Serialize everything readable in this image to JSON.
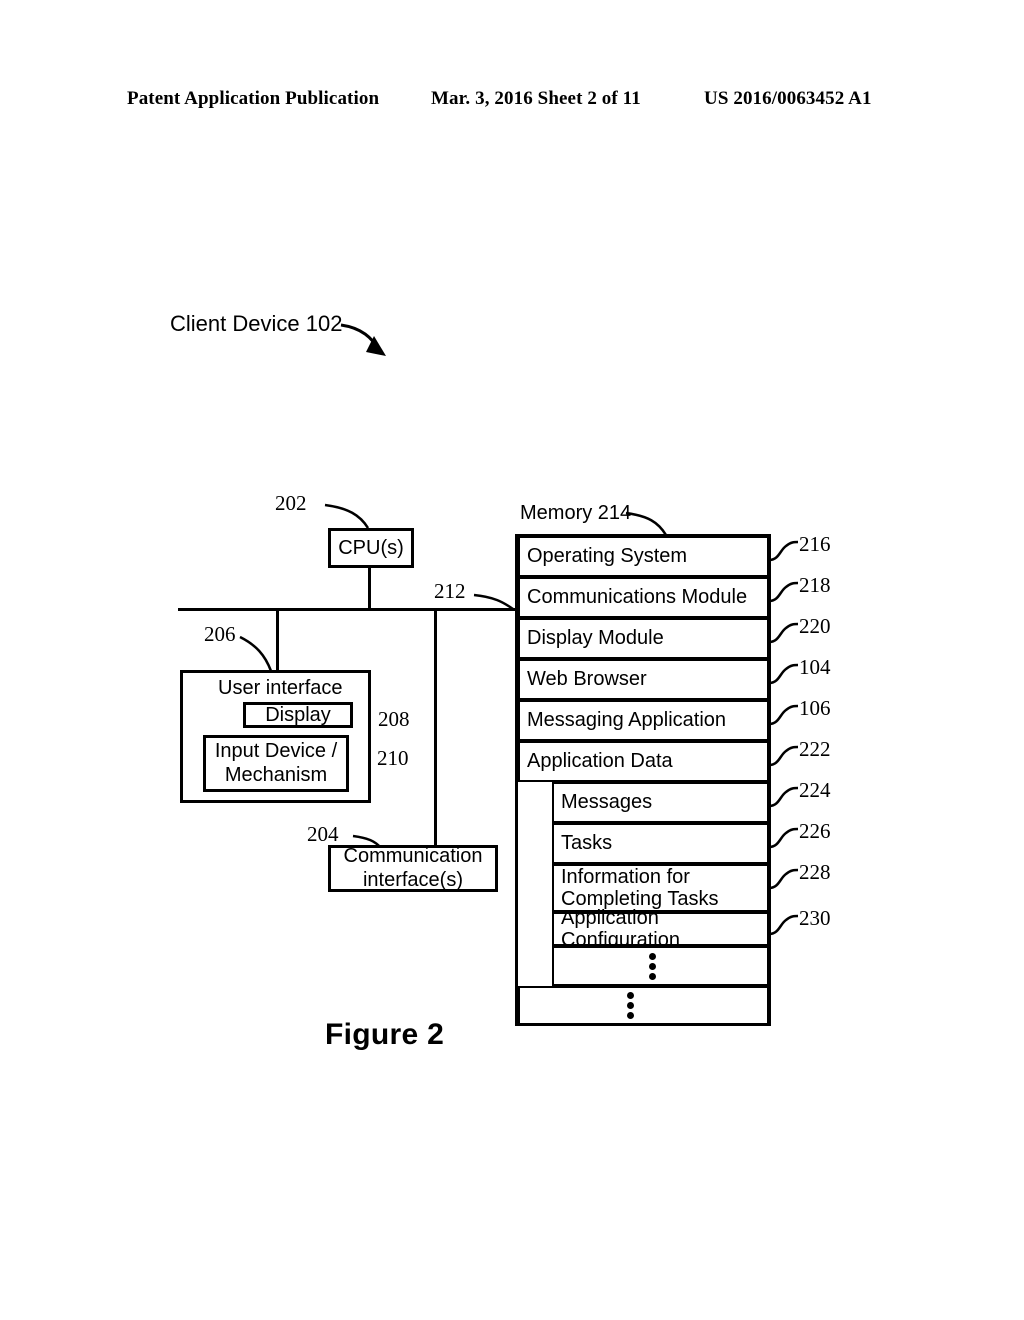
{
  "header": {
    "publication": "Patent Application Publication",
    "date_sheet": "Mar. 3, 2016  Sheet 2 of 11",
    "patent_number": "US 2016/0063452 A1"
  },
  "figure": {
    "caption": "Figure 2",
    "title_label": "Client Device 102"
  },
  "blocks": {
    "cpu": {
      "label": "CPU(s)",
      "ref": "202"
    },
    "bus": {
      "ref": "212"
    },
    "user_interface": {
      "label": "User interface",
      "ref": "206"
    },
    "display": {
      "label": "Display",
      "ref": "208"
    },
    "input_device": {
      "label": "Input Device /\nMechanism",
      "ref": "210"
    },
    "comm_interface": {
      "label": "Communication\ninterface(s)",
      "ref": "204"
    },
    "memory": {
      "label": "Memory 214",
      "ref": "214"
    }
  },
  "memory_rows": [
    {
      "label": "Operating System",
      "ref": "216"
    },
    {
      "label": "Communications Module",
      "ref": "218"
    },
    {
      "label": "Display Module",
      "ref": "220"
    },
    {
      "label": "Web Browser",
      "ref": "104"
    },
    {
      "label": "Messaging Application",
      "ref": "106"
    },
    {
      "label": "Application Data",
      "ref": "222"
    }
  ],
  "application_data_rows": [
    {
      "label": "Messages",
      "ref": "224"
    },
    {
      "label": "Tasks",
      "ref": "226"
    },
    {
      "label": "Information for\nCompleting Tasks",
      "ref": "228"
    },
    {
      "label": "Application Configuration",
      "ref": "230"
    }
  ],
  "colors": {
    "ink": "#000000",
    "paper": "#ffffff"
  }
}
